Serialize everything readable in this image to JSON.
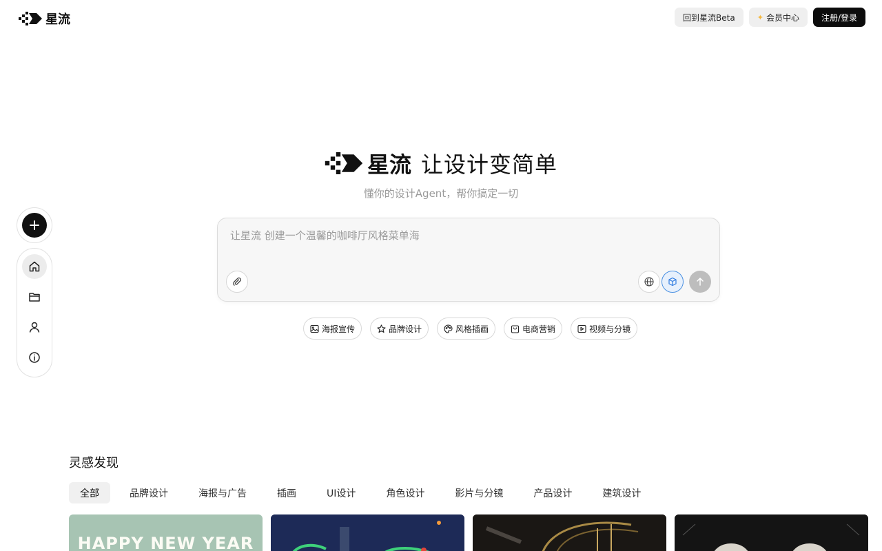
{
  "brand": {
    "name": "星流"
  },
  "top_actions": {
    "beta_label": "回到星流Beta",
    "member_label": "会员中心",
    "login_label": "注册/登录"
  },
  "hero": {
    "brand": "星流",
    "slogan": "让设计变简单",
    "subtitle": "懂你的设计Agent，帮你搞定一切"
  },
  "prompt": {
    "placeholder": "让星流 创建一个温馨的咖啡厅风格菜单海"
  },
  "chips": [
    {
      "label": "海报宣传",
      "icon": "image-icon"
    },
    {
      "label": "品牌设计",
      "icon": "star-icon"
    },
    {
      "label": "风格插画",
      "icon": "palette-icon"
    },
    {
      "label": "电商营销",
      "icon": "shopping-bag-icon"
    },
    {
      "label": "视频与分镜",
      "icon": "play-icon"
    }
  ],
  "inspiration": {
    "title": "灵感发现",
    "tabs": [
      "全部",
      "品牌设计",
      "海报与广告",
      "插画",
      "UI设计",
      "角色设计",
      "影片与分镜",
      "产品设计",
      "建筑设计"
    ],
    "card_1_text": "HAPPY NEW YEAR"
  },
  "sidebar": {
    "items": [
      "home-icon",
      "folder-icon",
      "user-icon",
      "info-icon"
    ]
  },
  "colors": {
    "accent": "#2f7be0",
    "dark": "#0c0c0c"
  }
}
